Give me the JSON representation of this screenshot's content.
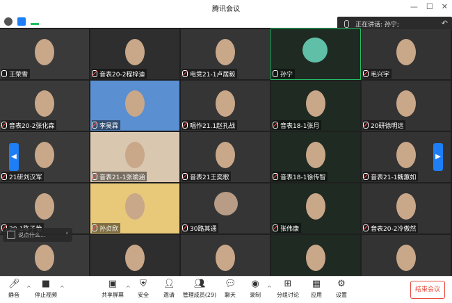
{
  "window": {
    "title": "腾讯会议"
  },
  "speaking": {
    "label": "正在讲话: 孙宁;"
  },
  "chat": {
    "placeholder": "说点什么..."
  },
  "participants": [
    {
      "name": "王荣雪",
      "muted": false
    },
    {
      "name": "音表20-2程梓迪",
      "muted": true
    },
    {
      "name": "电竞21-1卢居毅",
      "muted": true
    },
    {
      "name": "孙宁",
      "muted": false
    },
    {
      "name": "毛兴宇",
      "muted": true
    },
    {
      "name": "音表20-2张化森",
      "muted": true
    },
    {
      "name": "李昊霖",
      "muted": true
    },
    {
      "name": "唱作21.1赵孔战",
      "muted": true
    },
    {
      "name": "音表18-1张月",
      "muted": true
    },
    {
      "name": "20研徐明远",
      "muted": true
    },
    {
      "name": "21研刘汉军",
      "muted": true
    },
    {
      "name": "音表21-1张瑜涵",
      "muted": true
    },
    {
      "name": "音表21王奕歌",
      "muted": true
    },
    {
      "name": "音表18-1徐传智",
      "muted": true
    },
    {
      "name": "音表21-1魏蕙如",
      "muted": true
    },
    {
      "name": "20-1陈子怡",
      "muted": true
    },
    {
      "name": "孙贞欣",
      "muted": true
    },
    {
      "name": "30路其通",
      "muted": true
    },
    {
      "name": "张伟康",
      "muted": true
    },
    {
      "name": "音表20-2冷傲然",
      "muted": true
    },
    {
      "name": "",
      "muted": true
    },
    {
      "name": "",
      "muted": true
    },
    {
      "name": "",
      "muted": true
    },
    {
      "name": "",
      "muted": true
    },
    {
      "name": "",
      "muted": true
    }
  ],
  "toolbar": {
    "mute": "静音",
    "stop_video": "停止视频",
    "share": "共享屏幕",
    "security": "安全",
    "invite": "邀请",
    "members": "管理成员(29)",
    "chat": "聊天",
    "record": "录制",
    "breakout": "分组讨论",
    "apps": "应用",
    "settings": "设置",
    "end": "结束会议"
  },
  "colors": {
    "accent": "#1e7ef5",
    "end": "#e74c3c",
    "active_speaker": "#22c064"
  }
}
